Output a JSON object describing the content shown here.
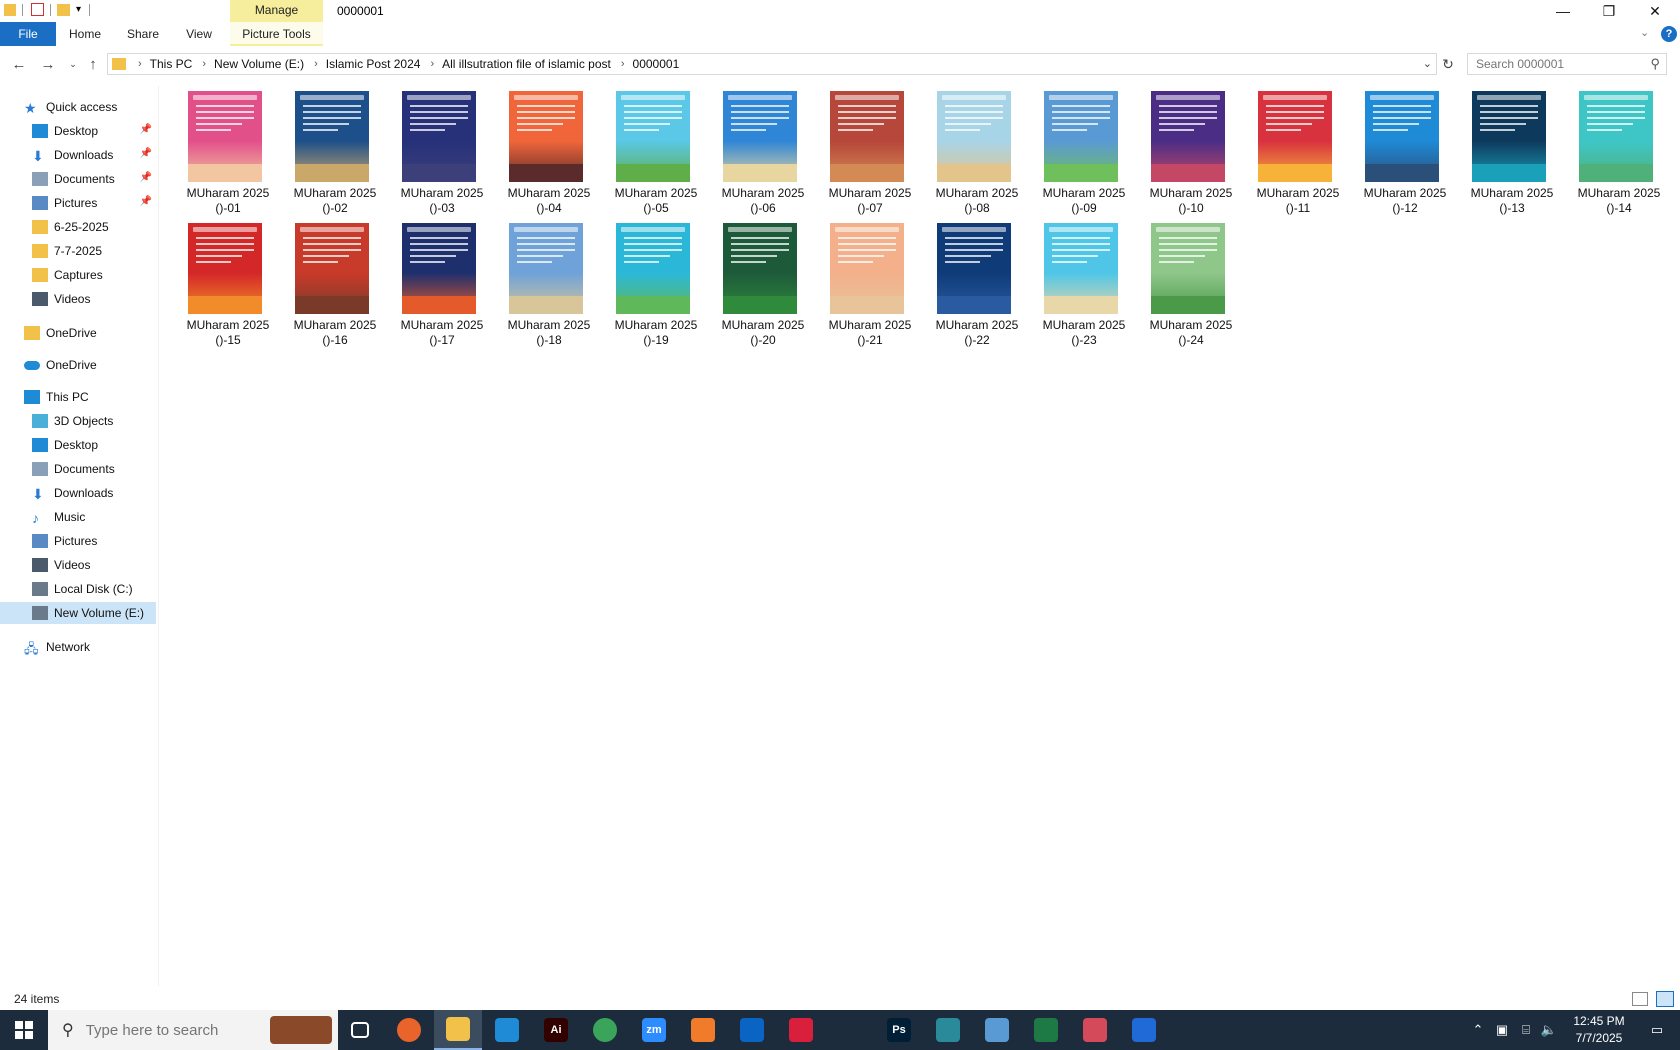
{
  "window": {
    "title": "0000001",
    "manage_label": "Manage",
    "minimize": "—",
    "restore": "❐",
    "close": "✕"
  },
  "ribbon": {
    "tabs": [
      "File",
      "Home",
      "Share",
      "View",
      "Picture Tools"
    ]
  },
  "address": {
    "crumbs": [
      "This PC",
      "New Volume (E:)",
      "Islamic Post 2024",
      "All illsutration file of islamic post",
      "0000001"
    ]
  },
  "search": {
    "placeholder": "Search 0000001"
  },
  "sidebar": {
    "items": [
      {
        "label": "Quick access",
        "icon": "star-icon",
        "pinned": false
      },
      {
        "label": "Desktop",
        "icon": "desktop-icon",
        "pinned": true
      },
      {
        "label": "Downloads",
        "icon": "download-icon",
        "pinned": true
      },
      {
        "label": "Documents",
        "icon": "documents-icon",
        "pinned": true
      },
      {
        "label": "Pictures",
        "icon": "pictures-icon",
        "pinned": true
      },
      {
        "label": "6-25-2025",
        "icon": "folder-icon",
        "pinned": false
      },
      {
        "label": "7-7-2025",
        "icon": "folder-icon",
        "pinned": false
      },
      {
        "label": "Captures",
        "icon": "folder-icon",
        "pinned": false
      },
      {
        "label": "Videos",
        "icon": "videos-icon",
        "pinned": false
      },
      {
        "label": "OneDrive",
        "icon": "folder-icon",
        "pinned": false
      },
      {
        "label": "OneDrive",
        "icon": "cloud-icon",
        "pinned": false
      },
      {
        "label": "This PC",
        "icon": "pc-icon",
        "pinned": false
      },
      {
        "label": "3D Objects",
        "icon": "cube-icon",
        "pinned": false
      },
      {
        "label": "Desktop",
        "icon": "desktop-icon",
        "pinned": false
      },
      {
        "label": "Documents",
        "icon": "documents-icon",
        "pinned": false
      },
      {
        "label": "Downloads",
        "icon": "download-icon",
        "pinned": false
      },
      {
        "label": "Music",
        "icon": "music-icon",
        "pinned": false
      },
      {
        "label": "Pictures",
        "icon": "pictures-icon",
        "pinned": false
      },
      {
        "label": "Videos",
        "icon": "videos-icon",
        "pinned": false
      },
      {
        "label": "Local Disk (C:)",
        "icon": "disk-icon",
        "pinned": false
      },
      {
        "label": "New Volume (E:)",
        "icon": "drive-icon",
        "pinned": false,
        "selected": true
      },
      {
        "label": "Network",
        "icon": "network-icon",
        "pinned": false
      }
    ]
  },
  "files": [
    {
      "line1": "MUharam 2025",
      "line2": "()-01",
      "color": "#e2508a",
      "ground": "#f2c6a0"
    },
    {
      "line1": "MUharam 2025",
      "line2": "()-02",
      "color": "#1d4f8a",
      "ground": "#c9a86a"
    },
    {
      "line1": "MUharam 2025",
      "line2": "()-03",
      "color": "#26317a",
      "ground": "#3d3f7a"
    },
    {
      "line1": "MUharam 2025",
      "line2": "()-04",
      "color": "#f0663a",
      "ground": "#5b2b2b"
    },
    {
      "line1": "MUharam 2025",
      "line2": "()-05",
      "color": "#5ac8e6",
      "ground": "#5fae4a"
    },
    {
      "line1": "MUharam 2025",
      "line2": "()-06",
      "color": "#2f86d6",
      "ground": "#e7d6a0"
    },
    {
      "line1": "MUharam 2025",
      "line2": "()-07",
      "color": "#b6473a",
      "ground": "#d48a55"
    },
    {
      "line1": "MUharam 2025",
      "line2": "()-08",
      "color": "#a8d4e8",
      "ground": "#e3c48a"
    },
    {
      "line1": "MUharam 2025",
      "line2": "()-09",
      "color": "#5a9ad4",
      "ground": "#6fbf5c"
    },
    {
      "line1": "MUharam 2025",
      "line2": "()-10",
      "color": "#4b2d86",
      "ground": "#c44866"
    },
    {
      "line1": "MUharam 2025",
      "line2": "()-11",
      "color": "#d8323f",
      "ground": "#f7b23a"
    },
    {
      "line1": "MUharam 2025",
      "line2": "()-12",
      "color": "#1f8ad6",
      "ground": "#2a4f78"
    },
    {
      "line1": "MUharam 2025",
      "line2": "()-13",
      "color": "#0d3a5c",
      "ground": "#1aa0b8"
    },
    {
      "line1": "MUharam 2025",
      "line2": "()-14",
      "color": "#3ec6c6",
      "ground": "#4fb07a"
    },
    {
      "line1": "MUharam 2025",
      "line2": "()-15",
      "color": "#d42828",
      "ground": "#f28c2a"
    },
    {
      "line1": "MUharam 2025",
      "line2": "()-16",
      "color": "#c83a2a",
      "ground": "#7a3a2a"
    },
    {
      "line1": "MUharam 2025",
      "line2": "()-17",
      "color": "#1e2f6e",
      "ground": "#e45a2a"
    },
    {
      "line1": "MUharam 2025",
      "line2": "()-18",
      "color": "#6ea2d8",
      "ground": "#d8c59a"
    },
    {
      "line1": "MUharam 2025",
      "line2": "()-19",
      "color": "#2bb8d8",
      "ground": "#5fb85a"
    },
    {
      "line1": "MUharam 2025",
      "line2": "()-20",
      "color": "#1d5a3a",
      "ground": "#2f8a3c"
    },
    {
      "line1": "MUharam 2025",
      "line2": "()-21",
      "color": "#f3b08a",
      "ground": "#e7c49a"
    },
    {
      "line1": "MUharam 2025",
      "line2": "()-22",
      "color": "#0f3b78",
      "ground": "#2a5aa0"
    },
    {
      "line1": "MUharam 2025",
      "line2": "()-23",
      "color": "#4fc6e8",
      "ground": "#e8d7a8"
    },
    {
      "line1": "MUharam 2025",
      "line2": "()-24",
      "color": "#8fc68a",
      "ground": "#4a9a4a"
    }
  ],
  "status": {
    "count": "24 items"
  },
  "taskbar": {
    "search_placeholder": "Type here to search",
    "apps": [
      {
        "name": "task-view-icon",
        "label": "",
        "color": "#1c2c3c"
      },
      {
        "name": "firefox-icon",
        "label": "",
        "color": "#e8642a"
      },
      {
        "name": "file-explorer-icon",
        "label": "",
        "color": "#f2c14a",
        "active": true
      },
      {
        "name": "vscode-icon",
        "label": "",
        "color": "#1f8ad6"
      },
      {
        "name": "illustrator-icon",
        "label": "Ai",
        "color": "#330000"
      },
      {
        "name": "chrome-icon",
        "label": "",
        "color": "#3aa55a"
      },
      {
        "name": "zoom-icon",
        "label": "zm",
        "color": "#2d8cff"
      },
      {
        "name": "xampp-icon",
        "label": "",
        "color": "#f07b2a"
      },
      {
        "name": "outlook-icon",
        "label": "",
        "color": "#0a64c4"
      },
      {
        "name": "creative-cloud-icon",
        "label": "",
        "color": "#da1f3d"
      },
      {
        "name": "pen-tool-icon",
        "label": "",
        "color": "#1c2c3c"
      },
      {
        "name": "photoshop-icon",
        "label": "Ps",
        "color": "#001e36"
      },
      {
        "name": "app-diamond-icon",
        "label": "",
        "color": "#2a8a9a"
      },
      {
        "name": "notepad-icon",
        "label": "",
        "color": "#5a9ad4"
      },
      {
        "name": "excel-icon",
        "label": "",
        "color": "#1d7a45"
      },
      {
        "name": "snipping-tool-icon",
        "label": "",
        "color": "#d44a5a"
      },
      {
        "name": "media-player-icon",
        "label": "",
        "color": "#1f6ad6"
      }
    ],
    "time": "12:45 PM",
    "date": "7/7/2025"
  }
}
